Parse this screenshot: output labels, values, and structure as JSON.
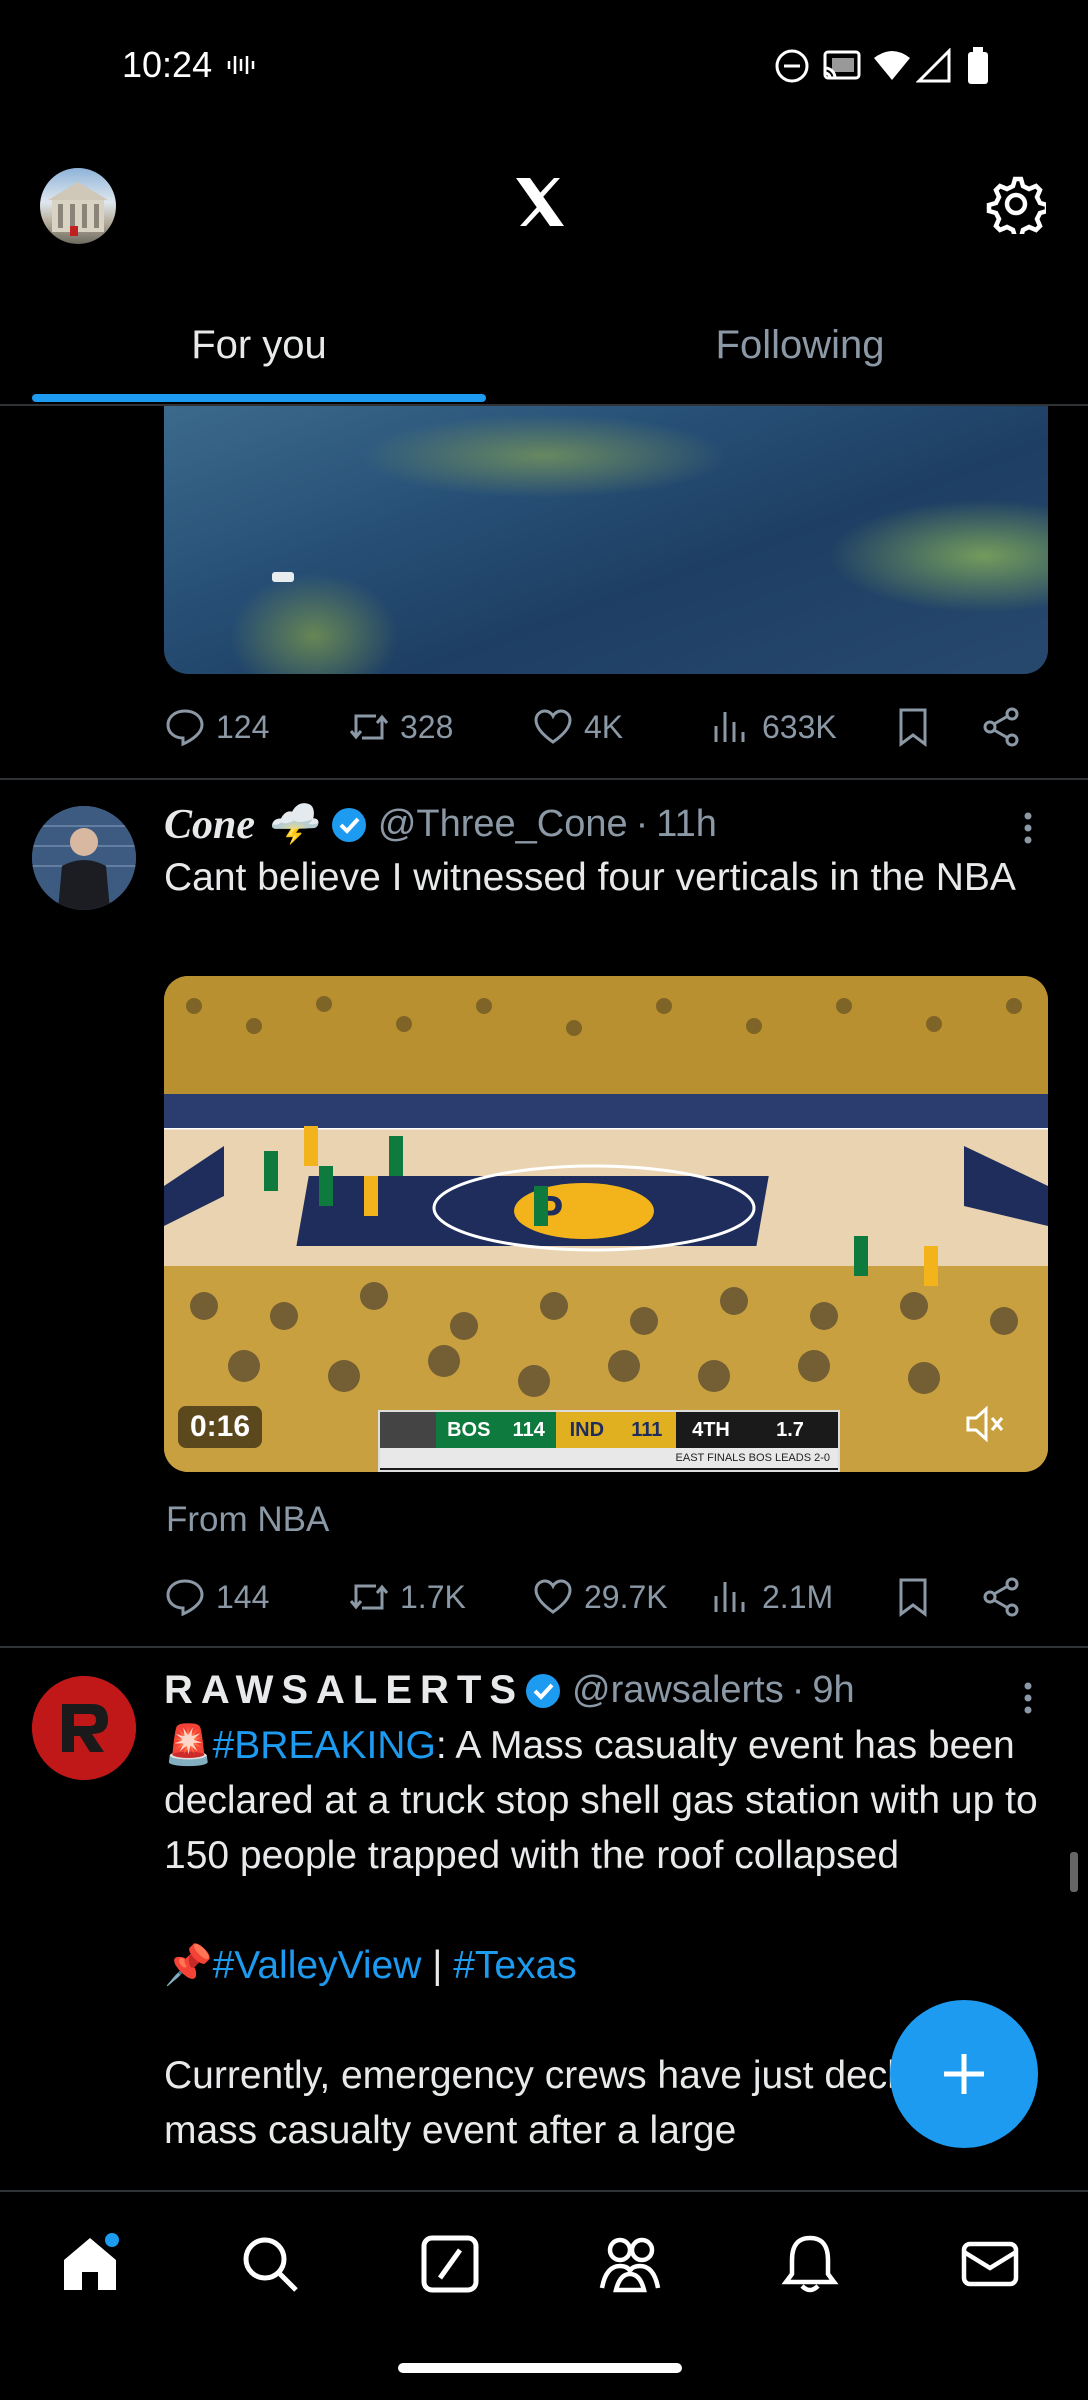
{
  "status_bar": {
    "time": "10:24"
  },
  "tabs": [
    {
      "label": "For you"
    },
    {
      "label": "Following"
    }
  ],
  "post1": {
    "actions": {
      "replies": "124",
      "reposts": "328",
      "likes": "4K",
      "views": "633K"
    }
  },
  "post2": {
    "name": "Cone 🌩️",
    "handle": "@Three_Cone",
    "time": "11h",
    "text": "Cant believe I witnessed four verticals in the NBA",
    "video": {
      "duration": "0:16",
      "score": {
        "team1": "BOS",
        "score1": "114",
        "team2": "IND",
        "score2": "111",
        "period": "4TH",
        "clock": "1.7",
        "note": "EAST FINALS BOS LEADS 2-0"
      }
    },
    "from": "From NBA",
    "actions": {
      "replies": "144",
      "reposts": "1.7K",
      "likes": "29.7K",
      "views": "2.1M"
    }
  },
  "post3": {
    "name": "RAWSALERTS",
    "handle": "@rawsalerts",
    "time": "9h",
    "line1_prefix": "🚨",
    "line1_tag": "#BREAKING",
    "line1_rest": ": A Mass casualty event has been declared at a truck stop shell gas station with up to 150 people trapped with the roof collapsed",
    "tags_prefix": "📌",
    "tag1": "#ValleyView",
    "tag_sep": " | ",
    "tag2": "#Texas",
    "line3": "Currently, emergency crews have just declared a mass casualty event after a large"
  },
  "colors": {
    "accent": "#1d9bf0",
    "background": "#000000",
    "muted": "#8b98a5"
  }
}
